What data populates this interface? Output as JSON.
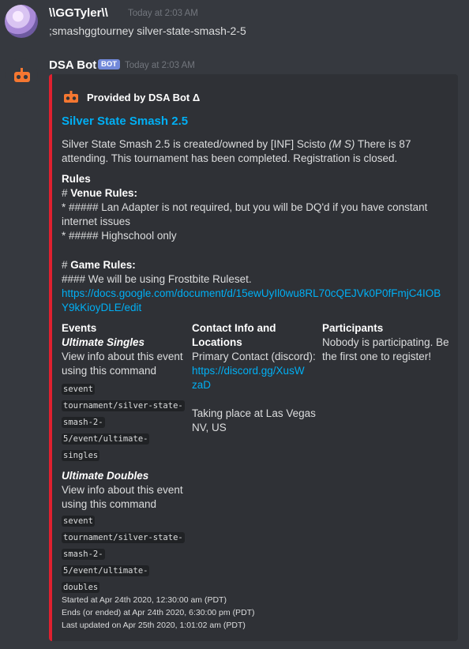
{
  "message1": {
    "username": "\\\\GGTyler\\\\",
    "timestamp": "Today at 2:03 AM",
    "text": ";smashggtourney silver-state-smash-2-5"
  },
  "message2": {
    "username": "DSA Bot",
    "badge": "BOT",
    "timestamp": "Today at 2:03 AM"
  },
  "embed": {
    "color": "#e0202f",
    "author": "Provided by DSA Bot Δ",
    "title": "Silver State Smash 2.5",
    "desc_line1_a": "Silver State Smash 2.5 is created/owned by [INF] Scisto ",
    "desc_line1_b": "(M S)",
    "desc_line1_c": " There is 87",
    "desc_line2": "attending. This tournament has been completed. Registration is closed.",
    "rules_heading": "Rules",
    "venue_prefix": "# ",
    "venue_title": "Venue Rules:",
    "venue_line1": "* ##### Lan Adapter is not required, but you will be DQ'd if you have constant",
    "venue_line2": "internet issues",
    "venue_line3": "* ##### Highschool only",
    "game_prefix": "# ",
    "game_title": "Game Rules:",
    "game_line1": "#### We will be using Frostbite Ruleset.",
    "game_link1": "https://docs.google.com/document/d/15ewUyIl0wu8RL70cQEJVk0P0fFmjC4IOB",
    "game_link2": "Y9kKioyDLE/edit",
    "events_heading": "Events",
    "event1_name": "Ultimate Singles",
    "event1_l1": "View info about this event",
    "event1_l2": "using this command",
    "event1_c1": "sevent",
    "event1_c2": "tournament/silver-state-",
    "event1_c3": "smash-2-",
    "event1_c4": "5/event/ultimate-",
    "event1_c5": "singles",
    "event2_name": "Ultimate Doubles",
    "event2_l1": "View info about this event",
    "event2_l2": "using this command",
    "event2_c1": "sevent",
    "event2_c2": "tournament/silver-state-",
    "event2_c3": "smash-2-",
    "event2_c4": "5/event/ultimate-",
    "event2_c5": "doubles",
    "contact_heading1": "Contact Info and",
    "contact_heading2": "Locations",
    "contact_l1": "Primary Contact (discord):",
    "contact_link1": "https://discord.gg/XusW",
    "contact_link2": "zaD",
    "location_l1": "Taking place at Las Vegas",
    "location_l2": "NV, US",
    "participants_heading": "Participants",
    "participants_l1": "Nobody is participating. Be",
    "participants_l2": "the first one to register!",
    "started": "Started at Apr 24th 2020, 12:30:00 am (PDT)",
    "ended": "Ends (or ended) at Apr 24th 2020, 6:30:00 pm (PDT)",
    "updated": "Last updated on Apr 25th 2020, 1:01:02 am (PDT)"
  }
}
